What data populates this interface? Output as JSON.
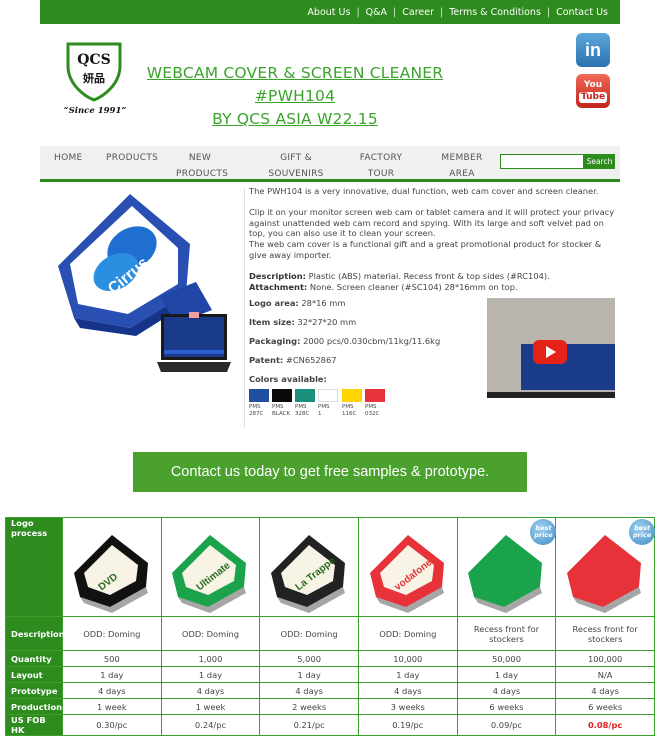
{
  "topnav": [
    "About Us",
    "Q&A",
    "Career",
    "Terms & Conditions",
    "Contact Us"
  ],
  "logo": {
    "name": "QCS",
    "chinese": "妍品",
    "tagline": "“Since 1991”"
  },
  "title_line1": "WEBCAM COVER & SCREEN CLEANER #PWH104",
  "title_line2": "BY QCS ASIA W22.15",
  "social": {
    "linkedin": "in",
    "youtube_top": "You",
    "youtube_bottom": "Tube"
  },
  "mainnav": {
    "home": "HOME",
    "products": "PRODUCTS",
    "new_products_1": "NEW",
    "new_products_2": "PRODUCTS",
    "gift_1": "GIFT &",
    "gift_2": "SOUVENIRS",
    "factory_1": "FACTORY",
    "factory_2": "TOUR",
    "member_1": "MEMBER",
    "member_2": "AREA",
    "search_button": "Search"
  },
  "description": {
    "intro": "The PWH104 is a very innovative, dual function, web cam cover and screen cleaner.",
    "para2": "Clip it on your monitor screen web cam or tablet camera and it will protect your privacy against unattended web cam record and spying. With its large and soft velvet pad on top, you can also use it to clean your screen.",
    "para3": "The web cam cover is a functional gift and a great promotional product for stocker & give away importer.",
    "desc_label": "Description:",
    "desc_value": " Plastic (ABS) material. Recess front & top sides (#RC104).",
    "attach_label": "Attachment:",
    "attach_value": " None. Screen cleaner (#SC104) 28*16mm on top."
  },
  "specs": {
    "logo_area_label": "Logo area:",
    "logo_area": " 28*16 mm",
    "item_size_label": "Item size:",
    "item_size": " 32*27*20 mm",
    "packaging_label": "Packaging:",
    "packaging": " 2000 pcs/0.030cbm/11kg/11.6kg",
    "patent_label": "Patent:",
    "patent": " #CN652867",
    "colors_label": "Colors available:"
  },
  "colors": [
    {
      "l1": "PMS",
      "l2": "287C",
      "hex": "#1f4fa0"
    },
    {
      "l1": "PMS",
      "l2": "BLACK",
      "hex": "#0a0a0a"
    },
    {
      "l1": "PMS",
      "l2": "328C",
      "hex": "#1b8f7e"
    },
    {
      "l1": "PMS",
      "l2": "1",
      "hex": "#ffffff"
    },
    {
      "l1": "PMS",
      "l2": "116C",
      "hex": "#ffd400"
    },
    {
      "l1": "PMS",
      "l2": "032C",
      "hex": "#e8323a"
    }
  ],
  "cta": "Contact us today to get free samples & prototype.",
  "table": {
    "row_labels": {
      "logo": "Logo process",
      "description": "Description",
      "quantity": "Quantity",
      "layout": "Layout",
      "prototype": "Prototype",
      "production": "Production",
      "price": "US FOB HK"
    },
    "columns": [
      {
        "color": "#111111",
        "print": "DVD",
        "desc": "ODD: Doming",
        "qty": "500",
        "layout": "1 day",
        "proto": "4 days",
        "prod": "1 week",
        "price": "0.30/pc"
      },
      {
        "color": "#1aa34a",
        "print": "Ultimate",
        "desc": "ODD: Doming",
        "qty": "1,000",
        "layout": "1 day",
        "proto": "4 days",
        "prod": "1 week",
        "price": "0.24/pc"
      },
      {
        "color": "#222222",
        "print": "La Trappe",
        "desc": "ODD: Doming",
        "qty": "5,000",
        "layout": "1 day",
        "proto": "4 days",
        "prod": "2 weeks",
        "price": "0.21/pc"
      },
      {
        "color": "#e8323a",
        "print": "vodafone",
        "desc": "ODD: Doming",
        "qty": "10,000",
        "layout": "1 day",
        "proto": "4 days",
        "prod": "3 weeks",
        "price": "0.19/pc"
      },
      {
        "color": "#1aa34a",
        "print": "",
        "desc": "Recess front for stockers",
        "qty": "50,000",
        "layout": "1 day",
        "proto": "4 days",
        "prod": "6 weeks",
        "price": "0.09/pc",
        "badge": "best price"
      },
      {
        "color": "#e8323a",
        "print": "",
        "desc": "Recess front for stockers",
        "qty": "100,000",
        "layout": "N/A",
        "proto": "4 days",
        "prod": "6 weeks",
        "price": "0.08/pc",
        "badge": "best price",
        "hot": true
      }
    ]
  },
  "product_image_text": "Cirrus"
}
